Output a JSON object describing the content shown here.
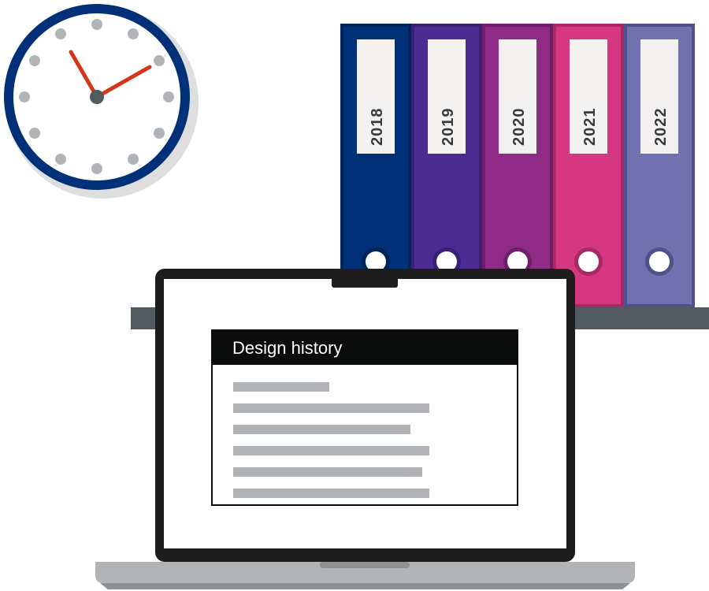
{
  "binders": [
    {
      "label": "2018",
      "color": "#003078"
    },
    {
      "label": "2019",
      "color": "#4c2c92"
    },
    {
      "label": "2020",
      "color": "#912b88"
    },
    {
      "label": "2021",
      "color": "#d53880"
    },
    {
      "label": "2022",
      "color": "#6f72af"
    }
  ],
  "window": {
    "title": "Design history"
  },
  "colors": {
    "clock_rim": "#003078",
    "clock_hands": "#d4351c",
    "clock_dots": "#b1b4b6",
    "shelf": "#505a5f",
    "laptop_body": "#1d1d1d",
    "laptop_base": "#b1b4b6",
    "text_placeholder": "#b1b4b6"
  },
  "icons": [
    "wall-clock-icon",
    "binder-icon",
    "laptop-icon"
  ]
}
